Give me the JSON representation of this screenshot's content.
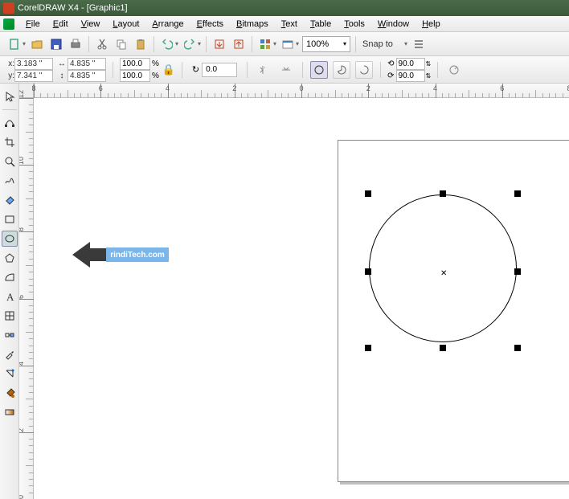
{
  "titlebar": {
    "title": "CorelDRAW X4 - [Graphic1]"
  },
  "menu": {
    "file": "File",
    "edit": "Edit",
    "view": "View",
    "layout": "Layout",
    "arrange": "Arrange",
    "effects": "Effects",
    "bitmaps": "Bitmaps",
    "text": "Text",
    "table": "Table",
    "tools": "Tools",
    "window": "Window",
    "help": "Help"
  },
  "toolbar1": {
    "zoom": "100%",
    "snap": "Snap to"
  },
  "props": {
    "x_label": "x:",
    "x": "3.183 \"",
    "y_label": "y:",
    "y": "7.341 \"",
    "w": "4.835 \"",
    "h": "4.835 \"",
    "sx": "100.0",
    "sx_unit": "%",
    "sy": "100.0",
    "sy_unit": "%",
    "rotation": "0.0",
    "angle1": "90.0",
    "angle2": "90.0"
  },
  "ruler_h": [
    "8",
    "6",
    "4",
    "2",
    "0",
    "2",
    "4",
    "6",
    "8"
  ],
  "ruler_v": [
    "12",
    "10",
    "8",
    "6",
    "4",
    "2",
    "0"
  ],
  "watermark": "rindiTech.com",
  "tool_names": [
    "pick",
    "shape",
    "crop",
    "zoom",
    "freehand",
    "smart-fill",
    "rectangle",
    "ellipse",
    "polygon",
    "basic-shapes",
    "text",
    "table",
    "dimension",
    "connector",
    "eyedropper",
    "outline",
    "fill",
    "interactive-fill"
  ]
}
